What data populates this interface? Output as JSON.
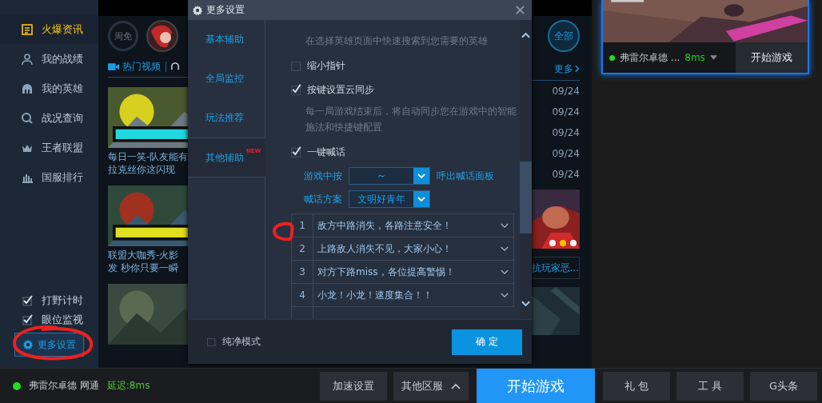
{
  "sidebar": {
    "items": [
      {
        "label": "火爆资讯",
        "selected": true
      },
      {
        "label": "我的战绩",
        "selected": false
      },
      {
        "label": "我的英雄",
        "selected": false
      },
      {
        "label": "战况查询",
        "selected": false
      },
      {
        "label": "王者联盟",
        "selected": false
      },
      {
        "label": "国服排行",
        "selected": false
      }
    ],
    "toggles": [
      {
        "label": "打野计时",
        "checked": true
      },
      {
        "label": "眼位监视",
        "checked": true
      }
    ],
    "more_button": "更多设置"
  },
  "feed": {
    "weekly_free": "周免",
    "tab": "热门视频",
    "all_button": "全部",
    "more_link": "更多",
    "articles": [
      {
        "kind": "picture",
        "caption": [
          "每日一笑-队友能有",
          "拉克丝你这闪现"
        ]
      },
      {
        "kind": "picture",
        "caption": [
          "联盟大咖秀-火影",
          "发 秒你只要一瞬"
        ]
      },
      {
        "kind": "picture"
      }
    ],
    "dates": [
      "09/24",
      "09/24",
      "09/24",
      "09/24",
      "09/24"
    ],
    "slide_dots": [
      {
        "selected": false
      },
      {
        "selected": true
      },
      {
        "selected": false
      }
    ],
    "banner_text": "抗玩家恶..."
  },
  "game_card": {
    "server": "弗雷尔卓德 ...",
    "ping": "8ms",
    "play": "开始游戏"
  },
  "dialog": {
    "title": "更多设置",
    "tabs": [
      {
        "label": "基本辅助",
        "selected": false,
        "new": false
      },
      {
        "label": "全局监控",
        "selected": false,
        "new": false
      },
      {
        "label": "玩法推荐",
        "selected": false,
        "new": false
      },
      {
        "label": "其他辅助",
        "selected": true,
        "new": true
      }
    ],
    "new_badge": "NEW",
    "options": [
      {
        "kind": "note",
        "text": "在选择英雄页面中快速搜索到您需要的英雄"
      },
      {
        "kind": "checkbox",
        "label": "缩小指针",
        "checked": false
      },
      {
        "kind": "checkbox",
        "label": "按键设置云同步",
        "checked": true
      },
      {
        "kind": "note",
        "text": "每一局游戏结束后，将自动同步您在游戏中的智能施法和快捷键配置"
      },
      {
        "kind": "checkbox",
        "label": "一键喊话",
        "checked": true
      },
      {
        "kind": "select",
        "label": "游戏中按",
        "value": "~",
        "suffix": "呼出喊话面板"
      },
      {
        "kind": "select",
        "label": "喊话方案",
        "value": "文明好青年"
      }
    ],
    "phrases": [
      {
        "number": "1",
        "text": "敌方中路消失，各路注意安全！"
      },
      {
        "number": "2",
        "text": "上路敌人消失不见，大家小心！"
      },
      {
        "number": "3",
        "text": "对方下路miss，各位提高警惕！"
      },
      {
        "number": "4",
        "text": "小龙！小龙！速度集合！！"
      }
    ],
    "pure_mode": {
      "label": "纯净模式",
      "checked": false
    },
    "confirm": "确 定"
  },
  "status_bar": {
    "server": "弗雷尔卓德 网通",
    "latency": "延迟:8ms",
    "buttons": [
      {
        "label": "加速设置",
        "kind": "plain"
      },
      {
        "label": "其他区服",
        "kind": "menu"
      },
      {
        "label": "开始游戏",
        "kind": "primary"
      },
      {
        "label": "礼 包",
        "kind": "plain"
      },
      {
        "label": "工 具",
        "kind": "plain"
      },
      {
        "label": "G头条",
        "kind": "plain"
      }
    ]
  }
}
